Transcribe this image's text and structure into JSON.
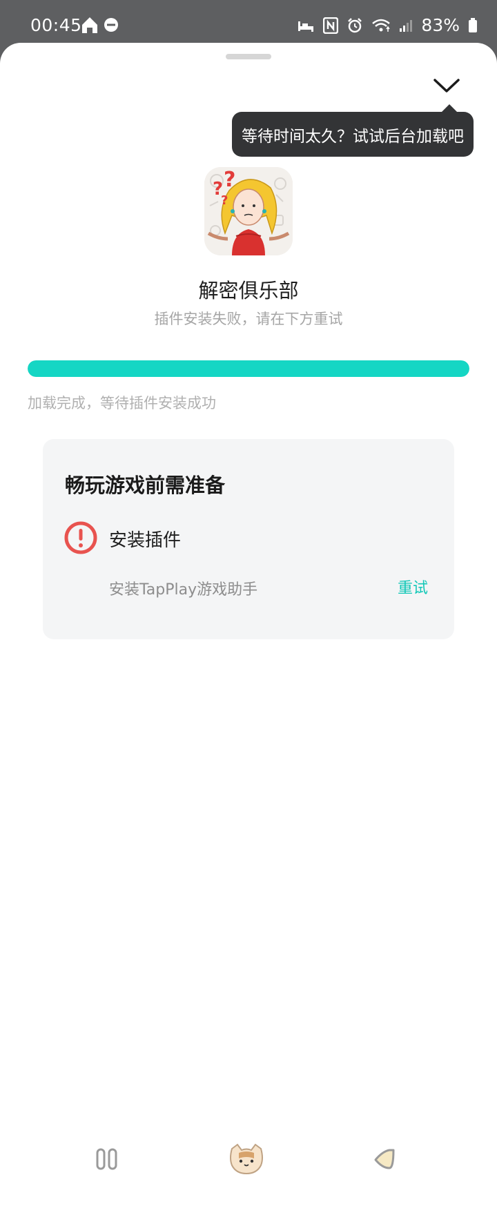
{
  "status_bar": {
    "time": "00:45",
    "battery": "83%",
    "icons": [
      "home-icon",
      "dnd-icon",
      "sleep-mode-icon",
      "nfc-icon",
      "alarm-icon",
      "wifi-icon",
      "signal-icon",
      "battery-icon"
    ]
  },
  "sheet": {
    "collapse_icon": "chevron-down-icon",
    "tooltip": "等待时间太久？试试后台加载吧",
    "app_name": "解密俱乐部",
    "app_subtitle": "插件安装失败，请在下方重试",
    "progress": {
      "value_percent": 100,
      "status": "加载完成，等待插件安装成功"
    }
  },
  "prep_card": {
    "title": "畅玩游戏前需准备",
    "step": {
      "icon": "error-circle-icon",
      "label": "安装插件",
      "description": "安装TapPlay游戏助手",
      "action": "重试"
    }
  },
  "bottom_nav": {
    "items": [
      "recents-icon",
      "home-cat-icon",
      "back-icon"
    ]
  },
  "colors": {
    "accent": "#15d6c4",
    "error": "#e8534f",
    "tooltip_bg": "#333436",
    "card_bg": "#f4f5f6"
  }
}
